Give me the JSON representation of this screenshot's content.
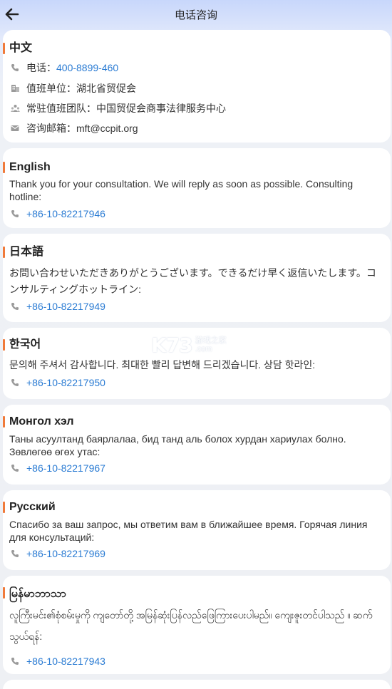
{
  "header": {
    "title": "电话咨询"
  },
  "cards": {
    "zh": {
      "title": "中文",
      "phone_label": "电话：",
      "phone": "400-8899-460",
      "unit_label": "值班单位：",
      "unit": "湖北省贸促会",
      "team_label": "常驻值班团队：",
      "team": "中国贸促会商事法律服务中心",
      "email_label": "咨询邮箱：",
      "email": "mft@ccpit.org"
    },
    "en": {
      "title": "English",
      "desc": "Thank you for your consultation. We will reply as soon as possible. Consulting hotline:",
      "phone": "+86-10-82217946"
    },
    "ja": {
      "title": "日本語",
      "desc": "お問い合わせいただきありがとうございます。できるだけ早く返信いたします。コンサルティングホットライン:",
      "phone": "+86-10-82217949"
    },
    "ko": {
      "title": "한국어",
      "desc": "문의해 주셔서 감사합니다. 최대한 빨리 답변해 드리겠습니다. 상담 핫라인:",
      "phone": "+86-10-82217950"
    },
    "mn": {
      "title": "Монгол хэл",
      "desc": "Таны асуултанд баярлалаа, бид танд аль болох хурдан хариулах болно. Зөвлөгөө өгөх утас:",
      "phone": "+86-10-82217967"
    },
    "ru": {
      "title": "Русский",
      "desc": "Спасибо за ваш запрос, мы ответим вам в ближайшее время. Горячая линия для консультаций:",
      "phone": "+86-10-82217969"
    },
    "my": {
      "title": "မြန်မာဘာသာ",
      "desc": "လူကြီးမင်း၏စုံစမ်းမှုကို ကျတော်တို့ အမြန်ဆုံးပြန်လည်ဖြေကြားပေးပါမည်။ ကျေးဇူးတင်ပါသည် ။ ဆက်သွယ်ရန်:",
      "phone": "+86-10-82217943"
    }
  },
  "watermark": {
    "logo": "K73",
    "line1": "游戏之家",
    "line2": ".com"
  },
  "colors": {
    "accent": "#f07a3a",
    "link": "#2a7bd3",
    "header_bg": "#c8d7fb"
  }
}
